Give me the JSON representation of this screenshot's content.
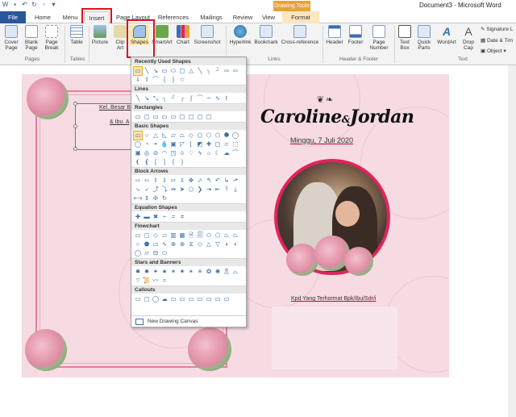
{
  "window": {
    "title": "Document3 - Microsoft Word",
    "context_tab_label": "Drawing Tools"
  },
  "tabs": [
    "File",
    "Home",
    "Menu",
    "Insert",
    "Page Layout",
    "References",
    "Mailings",
    "Review",
    "View",
    "Format"
  ],
  "ribbon": {
    "buttons": [
      "Cover Page",
      "Blank Page",
      "Page Break",
      "Table",
      "Picture",
      "Clip Art",
      "Shapes",
      "SmartArt",
      "Chart",
      "Screenshot",
      "Hyperlink",
      "Bookmark",
      "Cross-reference",
      "Header",
      "Footer",
      "Page Number",
      "Text Box",
      "Quick Parts",
      "WordArt",
      "Drop Cap"
    ],
    "small_items": [
      "Signature L",
      "Date & Tim",
      "Object"
    ],
    "groups": [
      "Pages",
      "Tables",
      "Links",
      "Header & Footer",
      "Text"
    ]
  },
  "shapes_menu": {
    "sections": [
      "Recently Used Shapes",
      "Lines",
      "Rectangles",
      "Basic Shapes",
      "Block Arrows",
      "Equation Shapes",
      "Flowchart",
      "Stars and Banners",
      "Callouts"
    ],
    "new_canvas_label": "New Drawing Canvas"
  },
  "document": {
    "textbox_line1": "Kel. Besar Ba",
    "textbox_line2": "& Ibu. A",
    "names_left": "Caroline",
    "names_amp": "&",
    "names_right": "Jordan",
    "date": "Minggu, 7 Juli 2020",
    "invite": "Kpd Yang Terhormat Bpk/Ibu/Sdr/i"
  },
  "colors": {
    "file_tab": "#2b579a",
    "highlight": "#e0101e",
    "page": "#f6dbe3",
    "photo_ring": "#e0245a"
  }
}
